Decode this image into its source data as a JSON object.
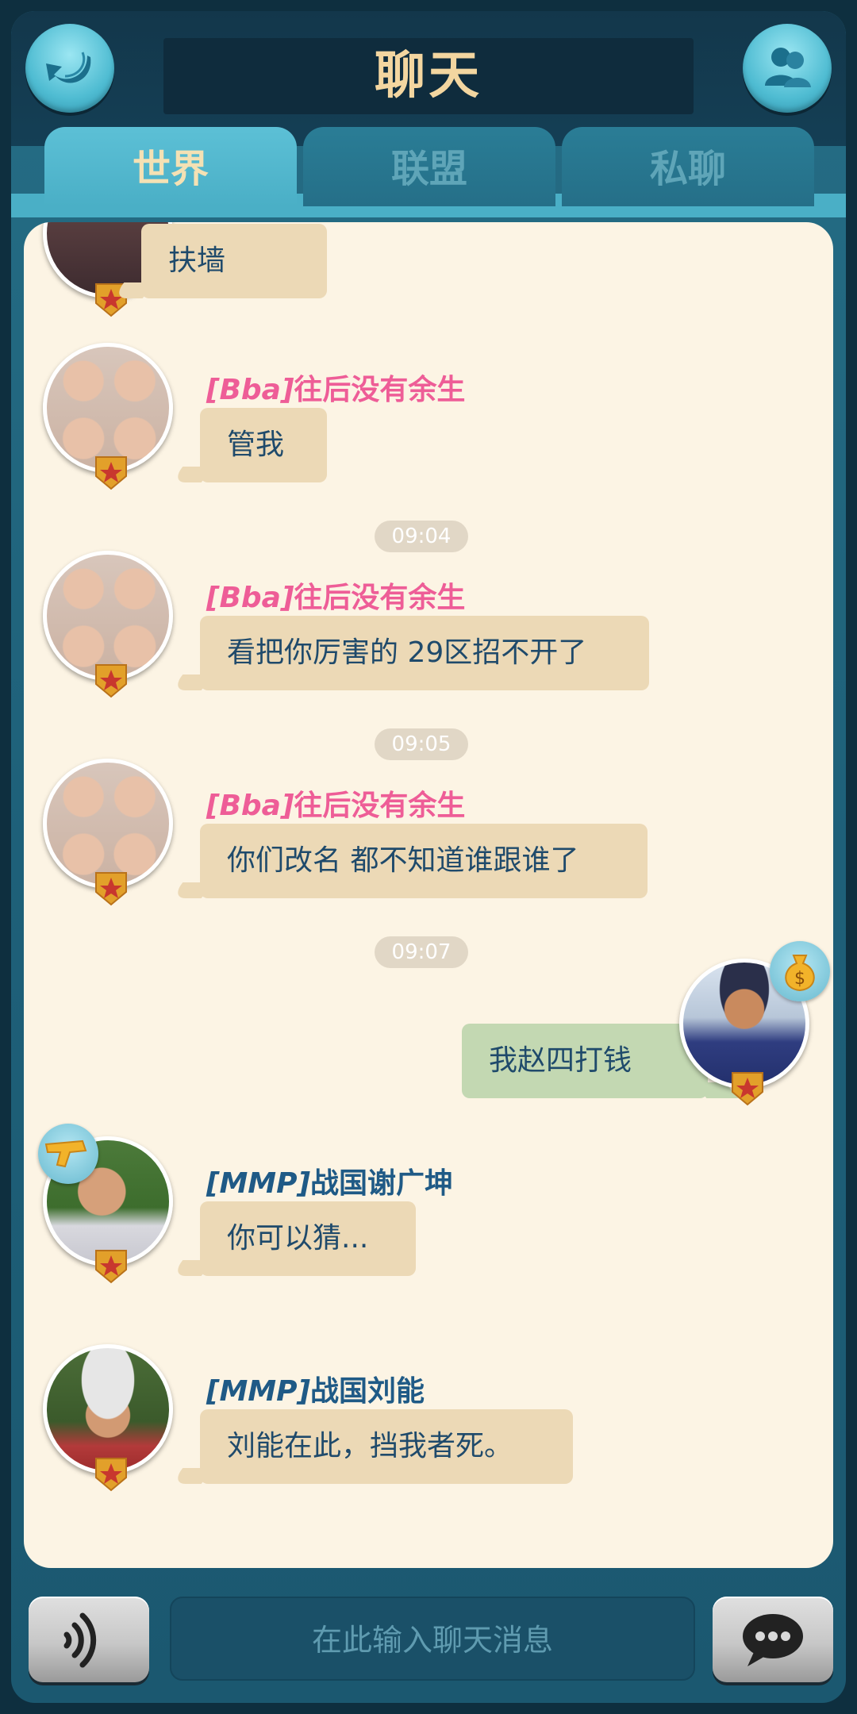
{
  "header": {
    "title": "聊天",
    "back_icon": "back-arrow-icon",
    "friends_icon": "friends-icon"
  },
  "tabs": [
    {
      "label": "世界",
      "active": true
    },
    {
      "label": "联盟",
      "active": false
    },
    {
      "label": "私聊",
      "active": false
    }
  ],
  "messages": [
    {
      "sender_tag": "",
      "sender_name": "",
      "text": "扶墙"
    },
    {
      "sender_tag": "[Bba]",
      "sender_name": "往后没有余生",
      "text": "管我"
    },
    {
      "time": "09:04"
    },
    {
      "sender_tag": "[Bba]",
      "sender_name": "往后没有余生",
      "text": "看把你厉害的 29区招不开了"
    },
    {
      "time": "09:05"
    },
    {
      "sender_tag": "[Bba]",
      "sender_name": "往后没有余生",
      "text": "你们改名 都不知道谁跟谁了"
    },
    {
      "time": "09:07"
    },
    {
      "sender_tag": "",
      "sender_name": "",
      "text": "我赵四打钱",
      "self": true
    },
    {
      "sender_tag": "[MMP]",
      "sender_name": "战国谢广坤",
      "text": "你可以猜..."
    },
    {
      "sender_tag": "[MMP]",
      "sender_name": "战国刘能",
      "text": "刘能在此，挡我者死。"
    }
  ],
  "input": {
    "placeholder": "在此输入聊天消息",
    "voice_icon": "voice-icon",
    "send_icon": "chat-bubble-icon"
  },
  "colors": {
    "pink_name": "#ee5d97",
    "blue_name": "#1f5a86",
    "bubble_other": "#ecd9b6",
    "bubble_self": "#c3d8b2",
    "panel": "#fcf4e4",
    "title": "#f3d6a0"
  }
}
